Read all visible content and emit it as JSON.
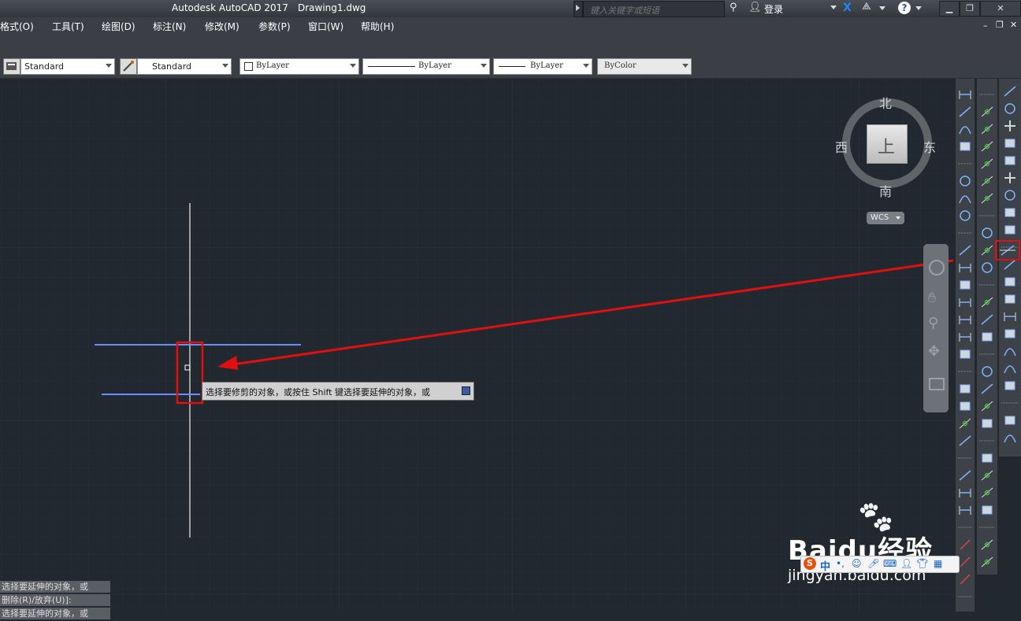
{
  "titlebar": {
    "app_title": "Autodesk AutoCAD 2017",
    "file_name": "Drawing1.dwg",
    "search_placeholder": "键入关键字或短语",
    "login_label": "登录",
    "help_label": "?"
  },
  "menu": {
    "items": [
      "格式(O)",
      "工具(T)",
      "绘图(D)",
      "标注(N)",
      "修改(M)",
      "参数(P)",
      "窗口(W)",
      "帮助(H)"
    ]
  },
  "properties": {
    "text_style": "Standard",
    "dim_style": "Standard",
    "color": "ByLayer",
    "linetype": "ByLayer",
    "lineweight": "ByLayer",
    "plot_style": "ByColor"
  },
  "viewcube": {
    "north": "北",
    "south": "南",
    "east": "东",
    "west": "西",
    "face": "上",
    "wcs": "WCS"
  },
  "tooltip": {
    "prompt": "选择要修剪的对象，或按住 Shift 键选择要延伸的对象，或"
  },
  "command_line": {
    "lines": [
      "选择要延伸的对象，或",
      "删除(R)/放弃(U)]:",
      "选择要延伸的对象，或"
    ]
  },
  "watermark": {
    "brand": "Baidu经验",
    "url": "jingyan.baidu.com",
    "ime_label": "中"
  },
  "colors": {
    "canvas": "#212830",
    "highlight_red": "#e01010",
    "line_blue": "#6a8cff",
    "line_white": "#c8c8c8"
  }
}
